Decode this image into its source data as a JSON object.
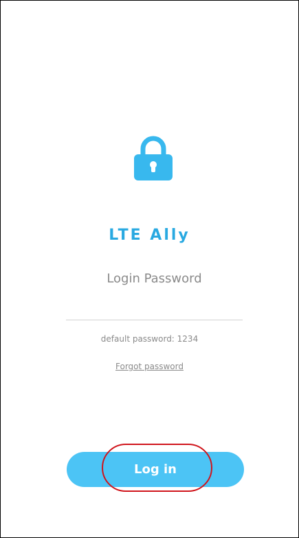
{
  "app": {
    "title": "LTE Ally"
  },
  "icons": {
    "lock": "lock-icon"
  },
  "login": {
    "password_placeholder": "Login Password",
    "password_value": "",
    "hint": "default password: 1234",
    "forgot_label": "Forgot password",
    "button_label": "Log in"
  },
  "colors": {
    "accent": "#29a9e1",
    "button": "#4cc4f5",
    "highlight": "#d0141b"
  }
}
